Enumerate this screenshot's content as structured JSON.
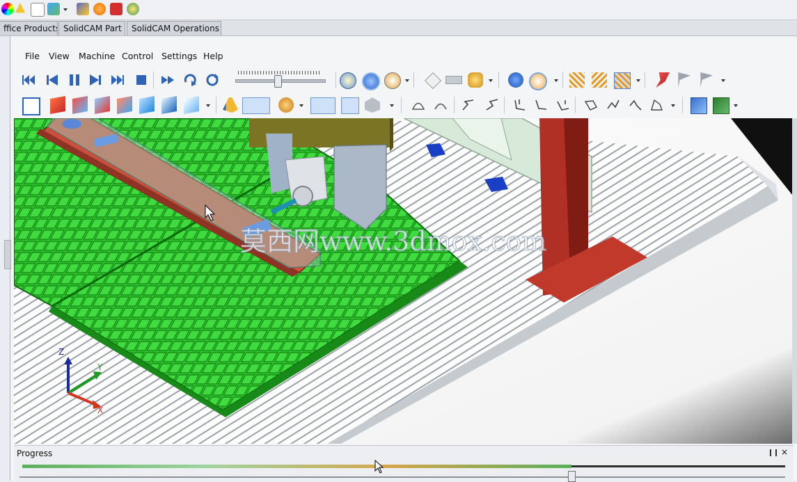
{
  "tabs": [
    "ffice Products",
    "SolidCAM Part",
    "SolidCAM Operations"
  ],
  "menu": [
    "File",
    "View",
    "Machine",
    "Control",
    "Settings",
    "Help"
  ],
  "progress_panel": {
    "title": "Progress",
    "close": "×"
  },
  "watermark": "莫西网www.3dmox.com",
  "axes": {
    "x": "X",
    "y": "Y",
    "z": "Z"
  },
  "colors": {
    "accent": "#3f6fc7",
    "table_green": "#2fc52f",
    "part_red": "#c0392b",
    "gantry": "#d7ead9"
  },
  "icons": {
    "top_toolbar": [
      "color-wheel-icon",
      "bell-icon",
      "copy-icon",
      "arrow-check-icon",
      "dropdown-icon",
      "tools-icon",
      "gear-icon",
      "stop-red-icon",
      "globe-icon"
    ],
    "playback": [
      "skip-start-icon",
      "step-back-icon",
      "pause-icon",
      "step-forward-icon",
      "skip-end-icon",
      "stop-icon",
      "fast-forward-icon",
      "redo-icon",
      "refresh-icon"
    ]
  },
  "slider": {
    "level": 0.47
  },
  "progress": {
    "level": 0.72
  }
}
